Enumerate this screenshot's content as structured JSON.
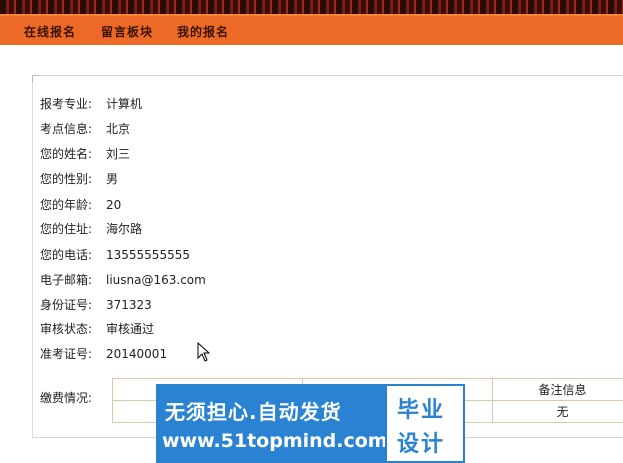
{
  "nav": {
    "items": [
      "在线报名",
      "留言板块",
      "我的报名"
    ]
  },
  "fields": [
    {
      "label": "报考专业:",
      "value": "计算机"
    },
    {
      "label": "考点信息:",
      "value": "北京"
    },
    {
      "label": "您的姓名:",
      "value": "刘三"
    },
    {
      "label": "您的性别:",
      "value": "男"
    },
    {
      "label": "您的年龄:",
      "value": "20"
    },
    {
      "label": "您的住址:",
      "value": "海尔路"
    },
    {
      "label": "您的电话:",
      "value": "13555555555"
    },
    {
      "label": "电子邮箱:",
      "value": "liusna@163.com"
    },
    {
      "label": "身份证号:",
      "value": "371323"
    },
    {
      "label": "审核状态:",
      "value": "审核通过"
    },
    {
      "label": "准考证号:",
      "value": "20140001"
    }
  ],
  "payment": {
    "label": "缴费情况:",
    "header_remark": "备注信息",
    "row_remark": "无"
  },
  "watermark": {
    "line1": "无须担心.自动发货",
    "line2": "www.51topmind.com",
    "right1": "毕业",
    "right2": "设计"
  },
  "colors": {
    "navbar": "#ec6a26",
    "watermark_blue": "#2a83d2"
  }
}
